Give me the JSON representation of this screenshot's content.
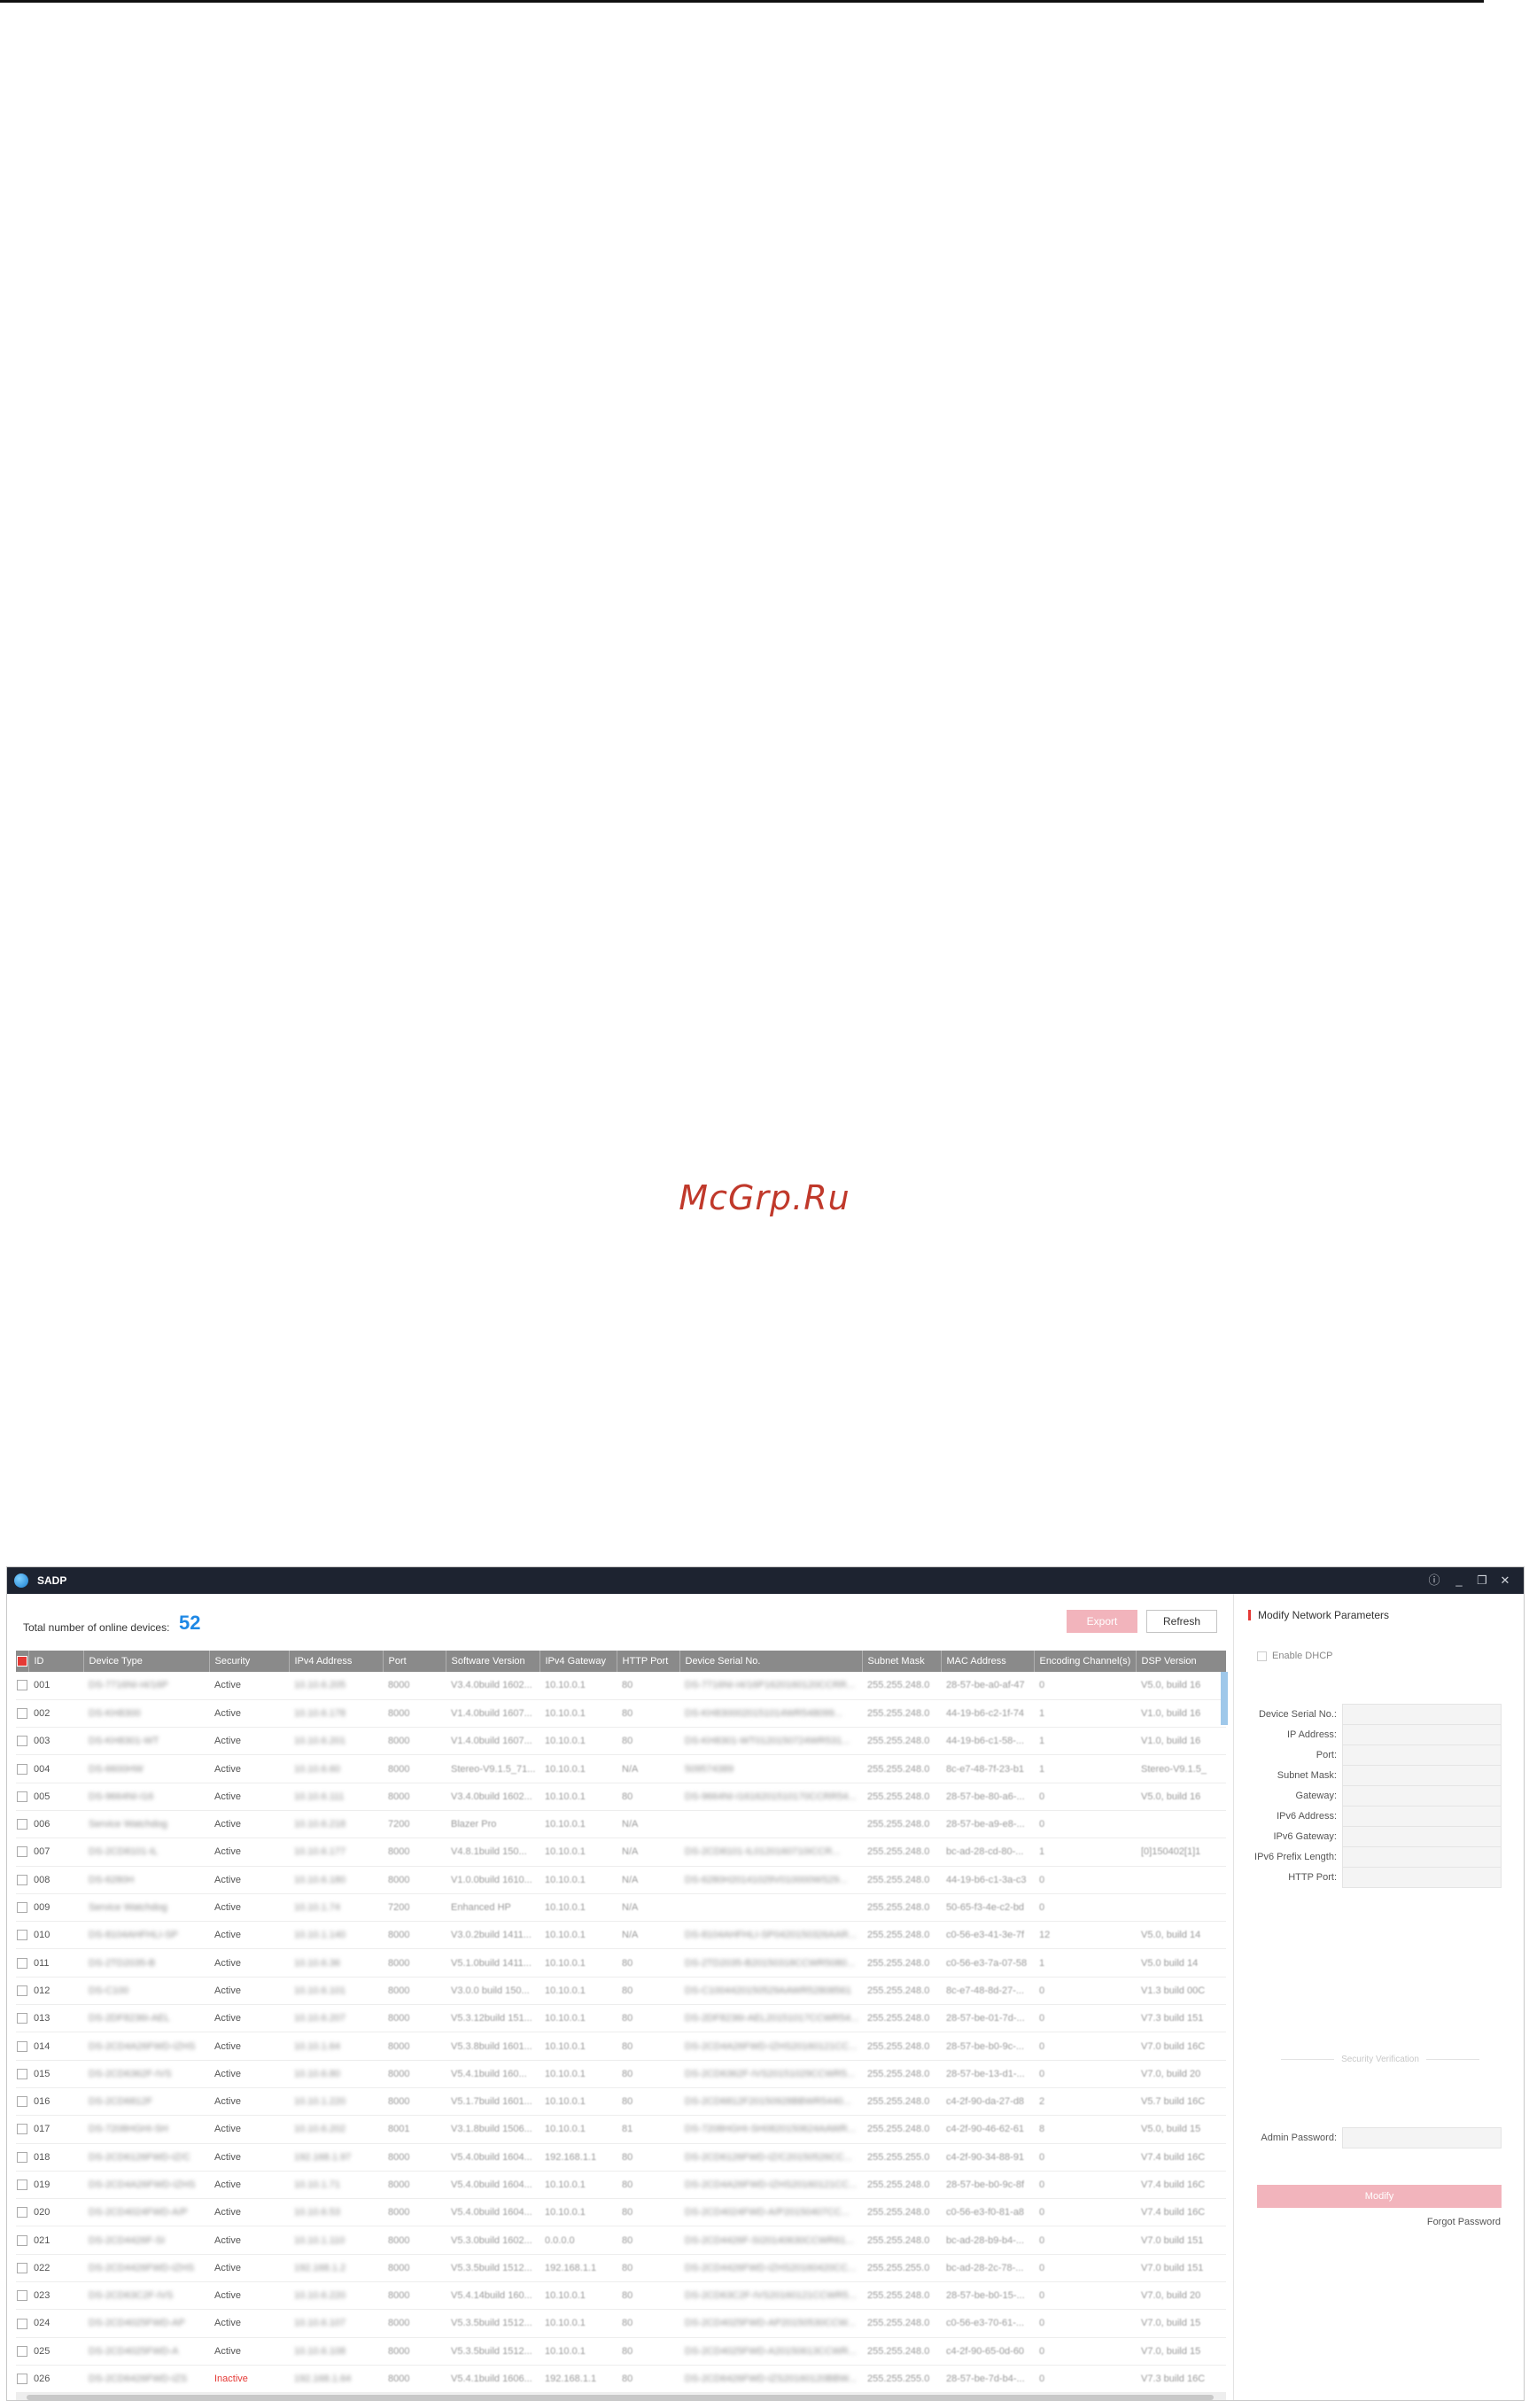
{
  "watermark": "McGrp.Ru",
  "window": {
    "title": "SADP",
    "controls": {
      "info": "ⓘ",
      "minimize": "_",
      "restore": "❐",
      "close": "✕"
    }
  },
  "header": {
    "total_label": "Total number of online devices:",
    "total_count": "52",
    "export_label": "Export",
    "refresh_label": "Refresh"
  },
  "table": {
    "columns": [
      "ID",
      "Device Type",
      "Security",
      "IPv4 Address",
      "Port",
      "Software Version",
      "IPv4 Gateway",
      "HTTP Port",
      "Device Serial No.",
      "Subnet Mask",
      "MAC Address",
      "Encoding Channel(s)",
      "DSP Version"
    ],
    "rows": [
      {
        "id": "001",
        "type": "DS-7716NI-I4/16P",
        "security": "Active",
        "ip": "10.10.6.205",
        "port": "8000",
        "sw": "V3.4.0build 1602...",
        "gw": "10.10.0.1",
        "http": "80",
        "serial": "DS-7716NI-I4/16P1620160120CCRR...",
        "mask": "255.255.248.0",
        "mac": "28-57-be-a0-af-47",
        "enc": "0",
        "dsp": "V5.0, build 16"
      },
      {
        "id": "002",
        "type": "DS-KH8300",
        "security": "Active",
        "ip": "10.10.6.178",
        "port": "8000",
        "sw": "V1.4.0build 1607...",
        "gw": "10.10.0.1",
        "http": "80",
        "serial": "DS-KH8300020151014WR548099...",
        "mask": "255.255.248.0",
        "mac": "44-19-b6-c2-1f-74",
        "enc": "1",
        "dsp": "V1.0, build 16"
      },
      {
        "id": "003",
        "type": "DS-KH8301-WT",
        "security": "Active",
        "ip": "10.10.6.201",
        "port": "8000",
        "sw": "V1.4.0build 1607...",
        "gw": "10.10.0.1",
        "http": "80",
        "serial": "DS-KH8301-WT0120150724WR531...",
        "mask": "255.255.248.0",
        "mac": "44-19-b6-c1-58-...",
        "enc": "1",
        "dsp": "V1.0, build 16"
      },
      {
        "id": "004",
        "type": "DS-6600HW",
        "security": "Active",
        "ip": "10.10.6.60",
        "port": "8000",
        "sw": "Stereo-V9.1.5_71...",
        "gw": "10.10.0.1",
        "http": "N/A",
        "serial": "509574389",
        "mask": "255.255.248.0",
        "mac": "8c-e7-48-7f-23-b1",
        "enc": "1",
        "dsp": "Stereo-V9.1.5_"
      },
      {
        "id": "005",
        "type": "DS-9664NI-I16",
        "security": "Active",
        "ip": "10.10.6.111",
        "port": "8000",
        "sw": "V3.4.0build 1602...",
        "gw": "10.10.0.1",
        "http": "80",
        "serial": "DS-9664NI-I1616201510170CCRR54...",
        "mask": "255.255.248.0",
        "mac": "28-57-be-80-a6-...",
        "enc": "0",
        "dsp": "V5.0, build 16"
      },
      {
        "id": "006",
        "type": "Service Watchdog",
        "security": "Active",
        "ip": "10.10.6.218",
        "port": "7200",
        "sw": "Blazer Pro",
        "gw": "10.10.0.1",
        "http": "N/A",
        "serial": "",
        "mask": "255.255.248.0",
        "mac": "28-57-be-a9-e8-...",
        "enc": "0",
        "dsp": ""
      },
      {
        "id": "007",
        "type": "DS-2CD8101-IL",
        "security": "Active",
        "ip": "10.10.6.177",
        "port": "8000",
        "sw": "V4.8.1build 150...",
        "gw": "10.10.0.1",
        "http": "N/A",
        "serial": "DS-2CD8101-IL0120160710ICCR...",
        "mask": "255.255.248.0",
        "mac": "bc-ad-28-cd-80-...",
        "enc": "1",
        "dsp": "[0]150402[1]1"
      },
      {
        "id": "008",
        "type": "DS-6280H",
        "security": "Active",
        "ip": "10.10.6.180",
        "port": "8000",
        "sw": "V1.0.0build 1610...",
        "gw": "10.10.0.1",
        "http": "N/A",
        "serial": "DS-6280H20141029V010000WS29...",
        "mask": "255.255.248.0",
        "mac": "44-19-b6-c1-3a-c3",
        "enc": "0",
        "dsp": ""
      },
      {
        "id": "009",
        "type": "Service Watchdog",
        "security": "Active",
        "ip": "10.10.1.74",
        "port": "7200",
        "sw": "Enhanced HP",
        "gw": "10.10.0.1",
        "http": "N/A",
        "serial": "",
        "mask": "255.255.248.0",
        "mac": "50-65-f3-4e-c2-bd",
        "enc": "0",
        "dsp": ""
      },
      {
        "id": "010",
        "type": "DS-8104AHFHLI-SP",
        "security": "Active",
        "ip": "10.10.1.140",
        "port": "8000",
        "sw": "V3.0.2build 1411...",
        "gw": "10.10.0.1",
        "http": "N/A",
        "serial": "DS-8104AHFHLI-SP0420150326AAR...",
        "mask": "255.255.248.0",
        "mac": "c0-56-e3-41-3e-7f",
        "enc": "12",
        "dsp": "V5.0, build 14"
      },
      {
        "id": "011",
        "type": "DS-2TD2035-B",
        "security": "Active",
        "ip": "10.10.6.36",
        "port": "8000",
        "sw": "V5.1.0build 1411...",
        "gw": "10.10.0.1",
        "http": "80",
        "serial": "DS-2TD2035-B20150318CCWR5080...",
        "mask": "255.255.248.0",
        "mac": "c0-56-e3-7a-07-58",
        "enc": "1",
        "dsp": "V5.0 build 14"
      },
      {
        "id": "012",
        "type": "DS-C100",
        "security": "Active",
        "ip": "10.10.6.101",
        "port": "8000",
        "sw": "V3.0.0 build 150...",
        "gw": "10.10.0.1",
        "http": "80",
        "serial": "DS-C1004420150529AAWR52808561",
        "mask": "255.255.248.0",
        "mac": "8c-e7-48-8d-27-...",
        "enc": "0",
        "dsp": "V1.3 build 00C"
      },
      {
        "id": "013",
        "type": "DS-2DF8236I-AEL",
        "security": "Active",
        "ip": "10.10.6.207",
        "port": "8000",
        "sw": "V5.3.12build 151...",
        "gw": "10.10.0.1",
        "http": "80",
        "serial": "DS-2DF8236I-AEL20151017CCWR54...",
        "mask": "255.255.248.0",
        "mac": "28-57-be-01-7d-...",
        "enc": "0",
        "dsp": "V7.3 build 151"
      },
      {
        "id": "014",
        "type": "DS-2CD4A26FWD-IZHS",
        "security": "Active",
        "ip": "10.10.1.64",
        "port": "8000",
        "sw": "V5.3.8build 1601...",
        "gw": "10.10.0.1",
        "http": "80",
        "serial": "DS-2CD4A26FWD-IZHS20160121CC...",
        "mask": "255.255.248.0",
        "mac": "28-57-be-b0-9c-...",
        "enc": "0",
        "dsp": "V7.0 build 16C"
      },
      {
        "id": "015",
        "type": "DS-2CD6362F-IVS",
        "security": "Active",
        "ip": "10.10.6.80",
        "port": "8000",
        "sw": "V5.4.1build 160...",
        "gw": "10.10.0.1",
        "http": "80",
        "serial": "DS-2CD6362F-IVS20151029CCWR5...",
        "mask": "255.255.248.0",
        "mac": "28-57-be-13-d1-...",
        "enc": "0",
        "dsp": "V7.0, build 20"
      },
      {
        "id": "016",
        "type": "DS-2CD6812F",
        "security": "Active",
        "ip": "10.10.1.220",
        "port": "8000",
        "sw": "V5.1.7build 1601...",
        "gw": "10.10.0.1",
        "http": "80",
        "serial": "DS-2CD6812F20150928BBWR5440...",
        "mask": "255.255.248.0",
        "mac": "c4-2f-90-da-27-d8",
        "enc": "2",
        "dsp": "V5.7 build 16C"
      },
      {
        "id": "017",
        "type": "DS-7208HGHI-SH",
        "security": "Active",
        "ip": "10.10.6.202",
        "port": "8001",
        "sw": "V3.1.8build 1506...",
        "gw": "10.10.0.1",
        "http": "81",
        "serial": "DS-7208HGHI-SH0820150624AAWR...",
        "mask": "255.255.248.0",
        "mac": "c4-2f-90-46-62-61",
        "enc": "8",
        "dsp": "V5.0, build 15"
      },
      {
        "id": "018",
        "type": "DS-2CD6126FWD-IZ/C",
        "security": "Active",
        "ip": "192.168.1.97",
        "port": "8000",
        "sw": "V5.4.0build 1604...",
        "gw": "192.168.1.1",
        "http": "80",
        "serial": "DS-2CD6126FWD-IZ/C20150526CC...",
        "mask": "255.255.255.0",
        "mac": "c4-2f-90-34-88-91",
        "enc": "0",
        "dsp": "V7.4 build 16C"
      },
      {
        "id": "019",
        "type": "DS-2CD4A26FWD-IZHS",
        "security": "Active",
        "ip": "10.10.1.71",
        "port": "8000",
        "sw": "V5.4.0build 1604...",
        "gw": "10.10.0.1",
        "http": "80",
        "serial": "DS-2CD4A26FWD-IZHS20160121CC...",
        "mask": "255.255.248.0",
        "mac": "28-57-be-b0-9c-8f",
        "enc": "0",
        "dsp": "V7.4 build 16C"
      },
      {
        "id": "020",
        "type": "DS-2CD4024FWD-A/P",
        "security": "Active",
        "ip": "10.10.6.53",
        "port": "8000",
        "sw": "V5.4.0build 1604...",
        "gw": "10.10.0.1",
        "http": "80",
        "serial": "DS-2CD4024FWD-A/P20150407CC...",
        "mask": "255.255.248.0",
        "mac": "c0-56-e3-f0-81-a8",
        "enc": "0",
        "dsp": "V7.4 build 16C"
      },
      {
        "id": "021",
        "type": "DS-2CD4426F-SI",
        "security": "Active",
        "ip": "10.10.1.110",
        "port": "8000",
        "sw": "V5.3.0build 1602...",
        "gw": "0.0.0.0",
        "http": "80",
        "serial": "DS-2CD4426F-SI20140630CCWR61...",
        "mask": "255.255.248.0",
        "mac": "bc-ad-28-b9-b4-...",
        "enc": "0",
        "dsp": "V7.0 build 151"
      },
      {
        "id": "022",
        "type": "DS-2CD4426FWD-IZHS",
        "security": "Active",
        "ip": "192.168.1.2",
        "port": "8000",
        "sw": "V5.3.5build 1512...",
        "gw": "192.168.1.1",
        "http": "80",
        "serial": "DS-2CD4426FWD-IZHS20160420CC...",
        "mask": "255.255.255.0",
        "mac": "bc-ad-28-2c-78-...",
        "enc": "0",
        "dsp": "V7.0 build 151"
      },
      {
        "id": "023",
        "type": "DS-2CD63C2F-IVS",
        "security": "Active",
        "ip": "10.10.6.220",
        "port": "8000",
        "sw": "V5.4.14build 160...",
        "gw": "10.10.0.1",
        "http": "80",
        "serial": "DS-2CD63C2F-IVS20160121CCWR5...",
        "mask": "255.255.248.0",
        "mac": "28-57-be-b0-15-...",
        "enc": "0",
        "dsp": "V7.0, build 20"
      },
      {
        "id": "024",
        "type": "DS-2CD4025FWD-AP",
        "security": "Active",
        "ip": "10.10.6.107",
        "port": "8000",
        "sw": "V5.3.5build 1512...",
        "gw": "10.10.0.1",
        "http": "80",
        "serial": "DS-2CD4025FWD-AP20150530CCW...",
        "mask": "255.255.248.0",
        "mac": "c0-56-e3-70-61-...",
        "enc": "0",
        "dsp": "V7.0, build 15"
      },
      {
        "id": "025",
        "type": "DS-2CD4025FWD-A",
        "security": "Active",
        "ip": "10.10.6.108",
        "port": "8000",
        "sw": "V5.3.5build 1512...",
        "gw": "10.10.0.1",
        "http": "80",
        "serial": "DS-2CD4025FWD-A20150613CCWR...",
        "mask": "255.255.248.0",
        "mac": "c4-2f-90-65-0d-60",
        "enc": "0",
        "dsp": "V7.0, build 15"
      },
      {
        "id": "026",
        "type": "DS-2CD6426FWD-IZS",
        "security": "Inactive",
        "ip": "192.168.1.64",
        "port": "8000",
        "sw": "V5.4.1build 1606...",
        "gw": "192.168.1.1",
        "http": "80",
        "serial": "DS-2CD6426FWD-IZS20160120BBW...",
        "mask": "255.255.255.0",
        "mac": "28-57-be-7d-b4-...",
        "enc": "0",
        "dsp": "V7.3 build 16C"
      }
    ]
  },
  "panel": {
    "title": "Modify Network Parameters",
    "enable_dhcp": "Enable DHCP",
    "fields": [
      "Device Serial No.:",
      "IP Address:",
      "Port:",
      "Subnet Mask:",
      "Gateway:",
      "IPv6 Address:",
      "IPv6 Gateway:",
      "IPv6 Prefix Length:",
      "HTTP Port:"
    ],
    "security_verification": "Security Verification",
    "admin_password": "Admin Password:",
    "modify_label": "Modify",
    "forgot_password": "Forgot Password"
  }
}
